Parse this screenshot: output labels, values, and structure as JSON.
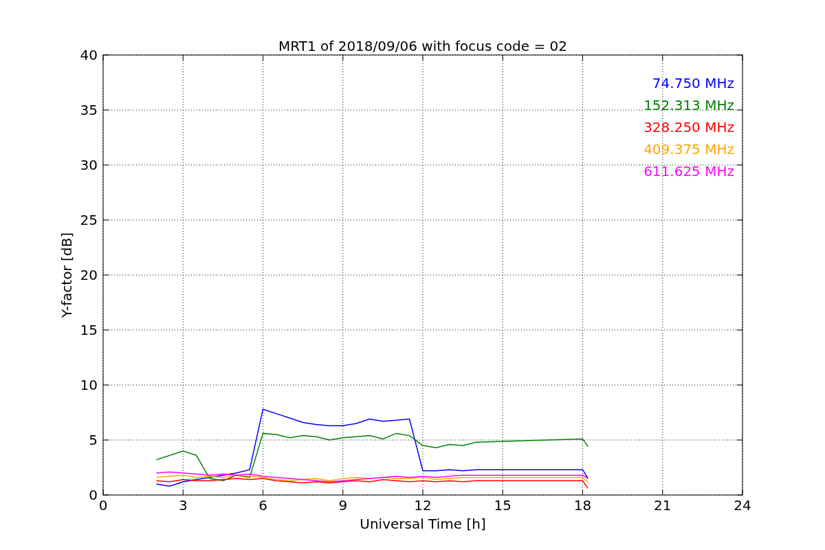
{
  "chart": {
    "chart_data": {
      "type": "line",
      "title": "MRT1 of 2018/09/06 with focus code = 02",
      "xlabel": "Universal Time [h]",
      "ylabel": "Y-factor [dB]",
      "x": [
        2,
        2.5,
        3,
        3.5,
        4,
        4.5,
        5,
        5.5,
        6,
        6.5,
        7,
        7.5,
        8,
        8.5,
        9,
        9.5,
        10,
        10.5,
        11,
        11.5,
        12,
        12.5,
        13,
        13.5,
        14,
        18,
        18.2
      ],
      "series": [
        {
          "name": "74.750 MHz",
          "color": "#0000ff",
          "values": [
            1.0,
            0.8,
            1.2,
            1.4,
            1.6,
            1.8,
            2.0,
            2.3,
            7.8,
            7.4,
            7.0,
            6.6,
            6.4,
            6.3,
            6.3,
            6.5,
            6.9,
            6.7,
            6.8,
            6.9,
            2.2,
            2.2,
            2.3,
            2.2,
            2.3,
            2.3,
            1.5
          ]
        },
        {
          "name": "152.313 MHz",
          "color": "#008000",
          "values": [
            3.2,
            3.6,
            4.0,
            3.6,
            1.5,
            1.3,
            1.8,
            1.6,
            5.6,
            5.5,
            5.2,
            5.4,
            5.3,
            5.0,
            5.2,
            5.3,
            5.4,
            5.1,
            5.6,
            5.4,
            4.5,
            4.3,
            4.6,
            4.5,
            4.8,
            5.1,
            4.4
          ]
        },
        {
          "name": "328.250 MHz",
          "color": "#ff0000",
          "values": [
            1.3,
            1.2,
            1.4,
            1.3,
            1.3,
            1.4,
            1.5,
            1.4,
            1.5,
            1.3,
            1.2,
            1.1,
            1.2,
            1.1,
            1.2,
            1.3,
            1.2,
            1.4,
            1.3,
            1.2,
            1.3,
            1.2,
            1.3,
            1.2,
            1.3,
            1.3,
            0.6
          ]
        },
        {
          "name": "409.375 MHz",
          "color": "#ffa500",
          "values": [
            1.6,
            1.7,
            1.8,
            1.6,
            1.7,
            1.6,
            1.8,
            1.7,
            1.6,
            1.4,
            1.3,
            1.4,
            1.5,
            1.3,
            1.5,
            1.6,
            1.5,
            1.6,
            1.5,
            1.5,
            1.6,
            1.4,
            1.5,
            1.6,
            1.6,
            1.6,
            1.2
          ]
        },
        {
          "name": "611.625 MHz",
          "color": "#ff00ff",
          "values": [
            2.0,
            2.1,
            2.0,
            1.9,
            1.8,
            1.9,
            1.8,
            1.9,
            1.7,
            1.6,
            1.5,
            1.4,
            1.3,
            1.2,
            1.3,
            1.4,
            1.5,
            1.6,
            1.7,
            1.6,
            1.7,
            1.6,
            1.7,
            1.8,
            1.8,
            1.8,
            1.5
          ]
        }
      ],
      "grid": true,
      "xlim": [
        0,
        24
      ],
      "ylim": [
        0,
        40
      ],
      "xticks": [
        0,
        3,
        6,
        9,
        12,
        15,
        18,
        21,
        24
      ],
      "yticks": [
        0,
        5,
        10,
        15,
        20,
        25,
        30,
        35,
        40
      ]
    }
  }
}
